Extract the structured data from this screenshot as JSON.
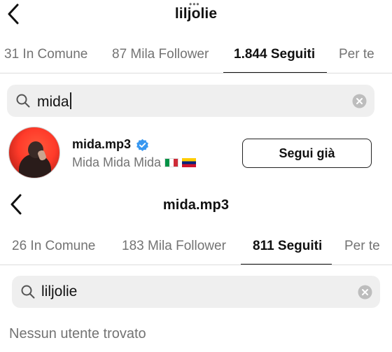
{
  "top": {
    "title": "liljolie",
    "more_dots": "•••",
    "tabs": [
      {
        "label": "31 In Comune"
      },
      {
        "label": "87 Mila Follower"
      },
      {
        "label": "1.844 Seguiti"
      },
      {
        "label": "Per te"
      }
    ],
    "search": {
      "value": "mida"
    },
    "result": {
      "username": "mida.mp3",
      "full_name": "Mida Mida Mida",
      "flags": [
        "flag-italy",
        "flag-venezuela"
      ],
      "button_label": "Segui già"
    }
  },
  "bottom": {
    "title": "mida.mp3",
    "tabs": [
      {
        "label": "26 In Comune"
      },
      {
        "label": "183 Mila Follower"
      },
      {
        "label": "811 Seguiti"
      },
      {
        "label": "Per te"
      }
    ],
    "search": {
      "value": "liljolie"
    },
    "empty_message": "Nessun utente trovato"
  },
  "colors": {
    "verified_badge": "#3797f0",
    "secondary_text": "#737373",
    "search_bg": "#efefef"
  }
}
